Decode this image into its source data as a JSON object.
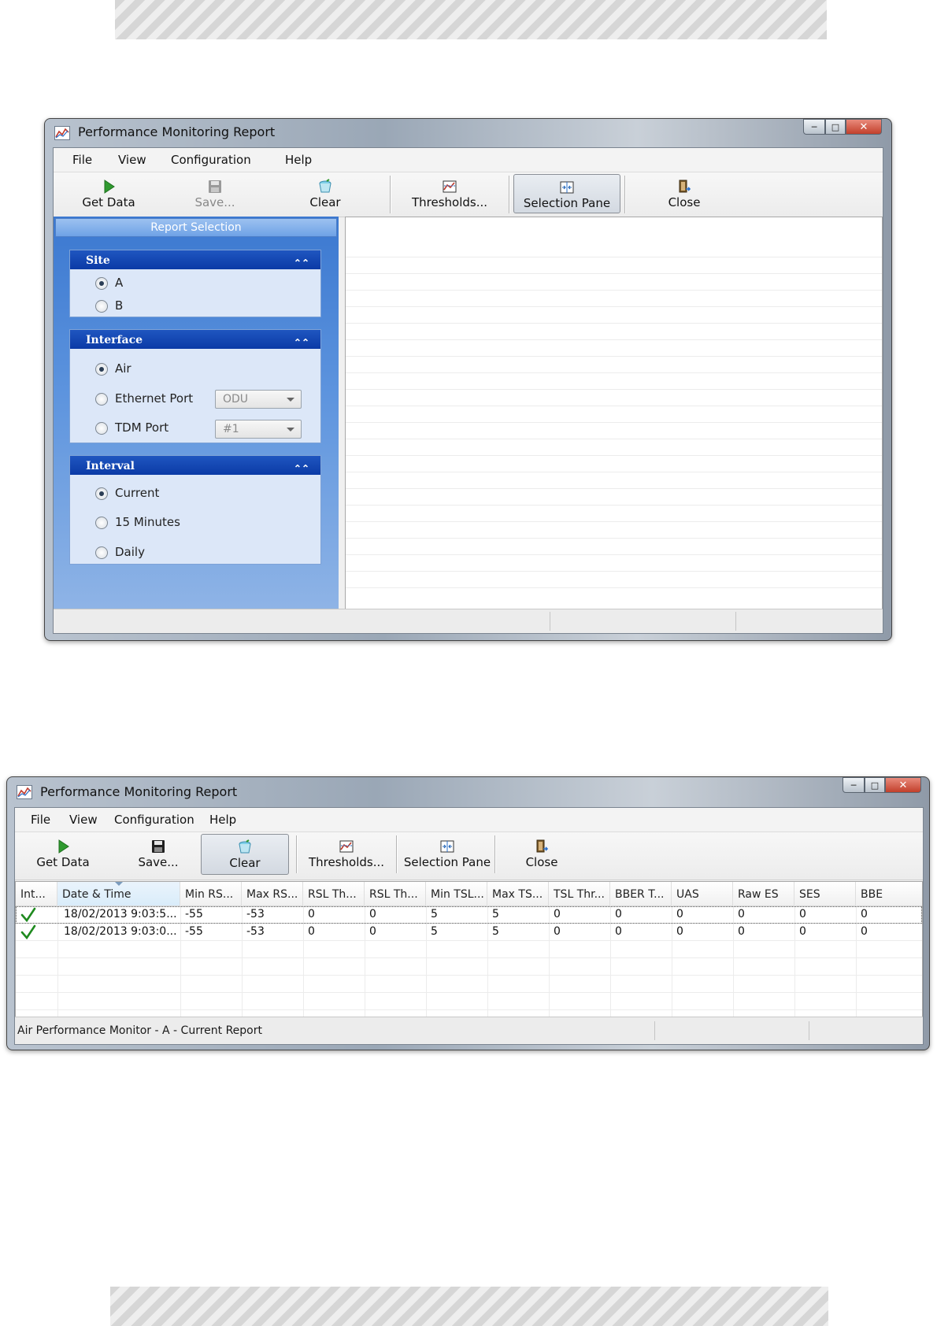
{
  "window1": {
    "title": "Performance Monitoring Report",
    "menu": [
      "File",
      "View",
      "Configuration",
      "Help"
    ],
    "toolbar": {
      "get_data": "Get Data",
      "save": "Save...",
      "clear": "Clear",
      "thresholds": "Thresholds...",
      "selection_pane": "Selection Pane",
      "close": "Close"
    },
    "selection_header": "Report Selection",
    "site": {
      "title": "Site",
      "options": [
        "A",
        "B"
      ],
      "selected": "A"
    },
    "interface": {
      "title": "Interface",
      "options": [
        "Air",
        "Ethernet Port",
        "TDM Port"
      ],
      "selected": "Air",
      "ethernet_combo": "ODU",
      "tdm_combo": "#1"
    },
    "interval": {
      "title": "Interval",
      "options": [
        "Current",
        "15 Minutes",
        "Daily"
      ],
      "selected": "Current"
    }
  },
  "window2": {
    "title": "Performance Monitoring Report",
    "menu": [
      "File",
      "View",
      "Configuration",
      "Help"
    ],
    "toolbar": {
      "get_data": "Get Data",
      "save": "Save...",
      "clear": "Clear",
      "thresholds": "Thresholds...",
      "selection_pane": "Selection Pane",
      "close": "Close"
    },
    "columns": [
      "Int...",
      "Date & Time",
      "Min RS...",
      "Max RS...",
      "RSL Th...",
      "RSL Th...",
      "Min TSL...",
      "Max TS...",
      "TSL Thr...",
      "BBER T...",
      "UAS",
      "Raw ES",
      "SES",
      "BBE"
    ],
    "rows": [
      [
        "",
        "18/02/2013 9:03:5...",
        "-55",
        "-53",
        "0",
        "0",
        "5",
        "5",
        "0",
        "0",
        "0",
        "0",
        "0",
        "0"
      ],
      [
        "",
        "18/02/2013 9:03:0...",
        "-55",
        "-53",
        "0",
        "0",
        "5",
        "5",
        "0",
        "0",
        "0",
        "0",
        "0",
        "0"
      ]
    ],
    "status": "Air Performance Monitor - A - Current Report"
  }
}
